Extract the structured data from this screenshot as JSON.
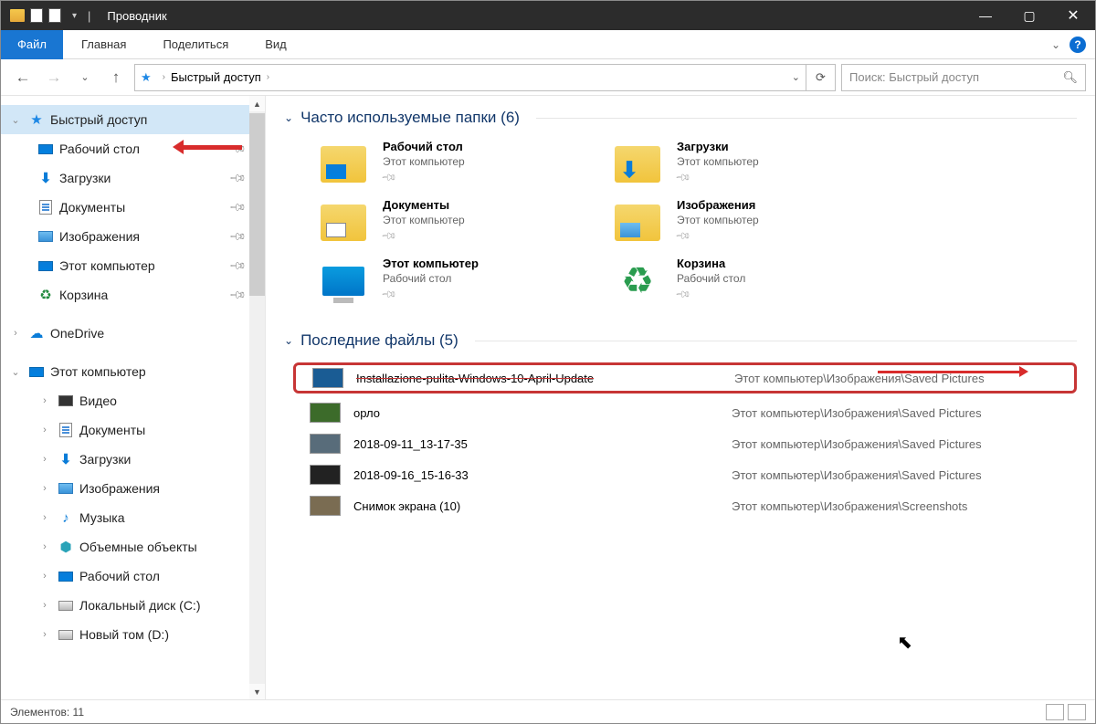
{
  "titlebar": {
    "title": "Проводник"
  },
  "ribbon": {
    "file": "Файл",
    "tabs": [
      "Главная",
      "Поделиться",
      "Вид"
    ]
  },
  "nav": {
    "crumb1": "Быстрый доступ",
    "search_placeholder": "Поиск: Быстрый доступ"
  },
  "tree": {
    "quick": "Быстрый доступ",
    "desktop": "Рабочий стол",
    "downloads": "Загрузки",
    "documents": "Документы",
    "pictures": "Изображения",
    "thispc": "Этот компьютер",
    "recycle": "Корзина",
    "onedrive": "OneDrive",
    "thispc_root": "Этот компьютер",
    "video": "Видео",
    "documents2": "Документы",
    "downloads2": "Загрузки",
    "pictures2": "Изображения",
    "music": "Музыка",
    "objects3d": "Объемные объекты",
    "desktop2": "Рабочий стол",
    "driveC": "Локальный диск (C:)",
    "driveD": "Новый том (D:)"
  },
  "sections": {
    "frequent": "Часто используемые папки (6)",
    "recent": "Последние файлы (5)"
  },
  "frequent": [
    {
      "name": "Рабочий стол",
      "sub": "Этот компьютер"
    },
    {
      "name": "Загрузки",
      "sub": "Этот компьютер"
    },
    {
      "name": "Документы",
      "sub": "Этот компьютер"
    },
    {
      "name": "Изображения",
      "sub": "Этот компьютер"
    },
    {
      "name": "Этот компьютер",
      "sub": "Рабочий стол"
    },
    {
      "name": "Корзина",
      "sub": "Рабочий стол"
    }
  ],
  "recent": [
    {
      "name": "Installazione-pulita-Windows-10-April-Update",
      "path": "Этот компьютер\\Изображения\\Saved Pictures"
    },
    {
      "name": "орло",
      "path": "Этот компьютер\\Изображения\\Saved Pictures"
    },
    {
      "name": "2018-09-11_13-17-35",
      "path": "Этот компьютер\\Изображения\\Saved Pictures"
    },
    {
      "name": "2018-09-16_15-16-33",
      "path": "Этот компьютер\\Изображения\\Saved Pictures"
    },
    {
      "name": "Снимок экрана (10)",
      "path": "Этот компьютер\\Изображения\\Screenshots"
    }
  ],
  "status": {
    "items": "Элементов: 11"
  }
}
